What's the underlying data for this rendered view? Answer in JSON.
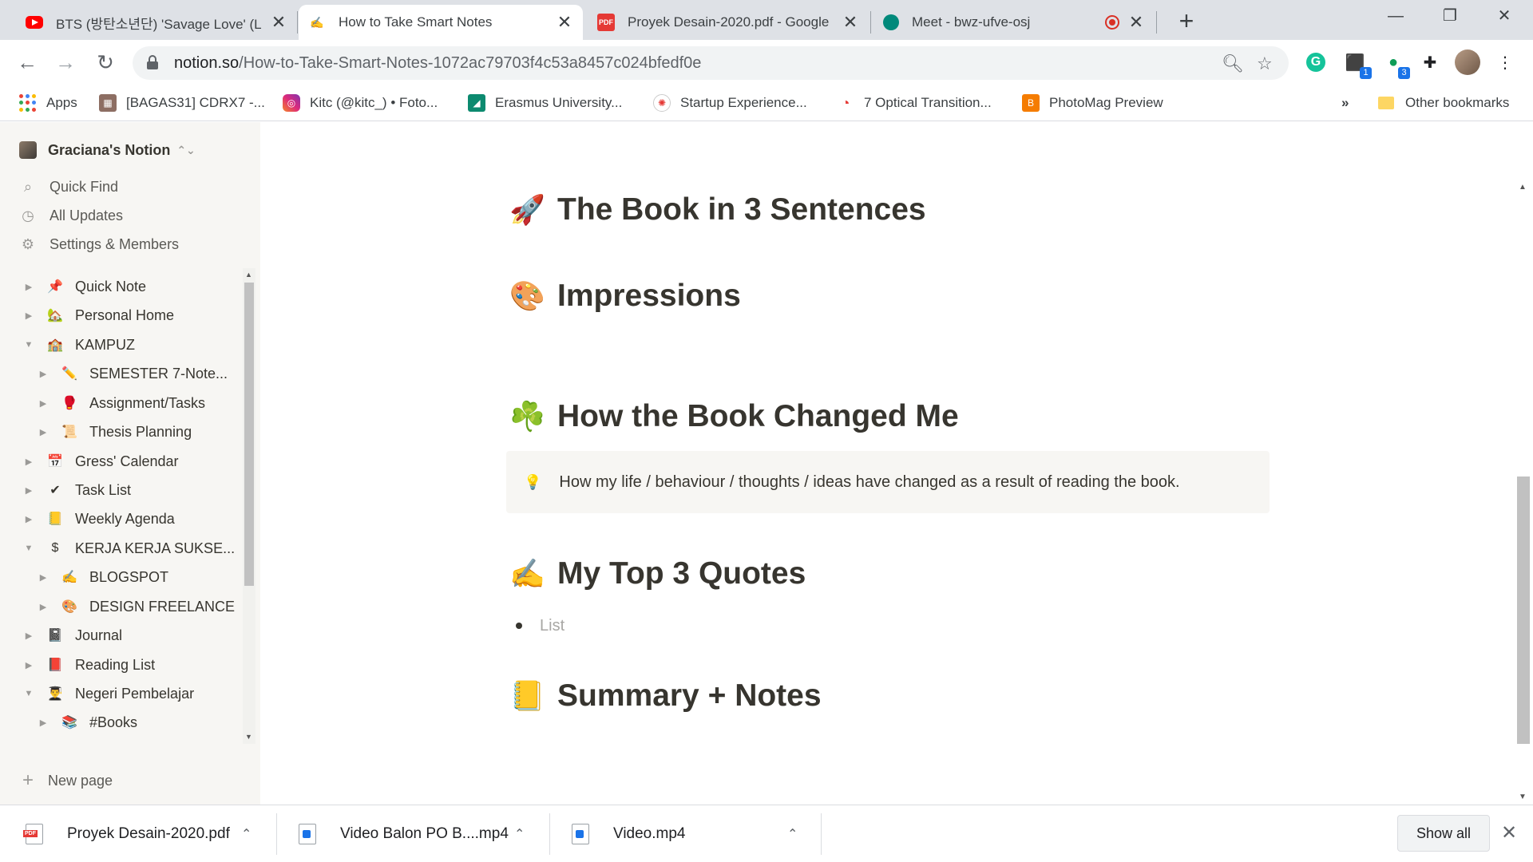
{
  "browser": {
    "tabs": [
      {
        "title": "BTS (방탄소년단) 'Savage Love' (L",
        "icon": "youtube-icon"
      },
      {
        "title": "How to Take Smart Notes",
        "icon": "writing-hand-icon",
        "active": true
      },
      {
        "title": "Proyek Desain-2020.pdf - Google",
        "icon": "pdf-icon"
      },
      {
        "title": "Meet - bwz-ufve-osj",
        "icon": "google-meet-icon",
        "recording": true
      }
    ],
    "url_host": "notion.so",
    "url_path": "/How-to-Take-Smart-Notes-1072ac79703f4c53a8457c024bfedf0e",
    "extension_badges": [
      "1",
      "3"
    ],
    "bookmarks": [
      {
        "label": "Apps",
        "icon": "apps-grid-icon"
      },
      {
        "label": "[BAGAS31] CDRX7 -...",
        "icon": "bagas31-icon"
      },
      {
        "label": "Kitc (@kitc_) • Foto...",
        "icon": "instagram-icon"
      },
      {
        "label": "Erasmus University...",
        "icon": "erasmus-icon"
      },
      {
        "label": "Startup Experience...",
        "icon": "startup-icon"
      },
      {
        "label": "7 Optical Transition...",
        "icon": "optical-icon"
      },
      {
        "label": "PhotoMag Preview",
        "icon": "blogger-icon"
      }
    ],
    "bookmarks_overflow": "»",
    "other_bookmarks": "Other bookmarks"
  },
  "sidebar": {
    "workspace": "Graciana's Notion",
    "top_items": [
      {
        "label": "Quick Find",
        "icon": "search-icon"
      },
      {
        "label": "All Updates",
        "icon": "clock-icon"
      },
      {
        "label": "Settings & Members",
        "icon": "gear-icon"
      }
    ],
    "tree": [
      {
        "label": "Quick Note",
        "emoji": "📌",
        "toggle": "▶",
        "depth": 0
      },
      {
        "label": "Personal Home",
        "emoji": "🏡",
        "toggle": "▶",
        "depth": 0
      },
      {
        "label": "KAMPUZ",
        "emoji": "🏫",
        "toggle": "▼",
        "depth": 0
      },
      {
        "label": "SEMESTER 7-Note...",
        "emoji": "✏️",
        "toggle": "▶",
        "depth": 1
      },
      {
        "label": "Assignment/Tasks",
        "emoji": "🥊",
        "toggle": "▶",
        "depth": 1
      },
      {
        "label": "Thesis Planning",
        "emoji": "📜",
        "toggle": "▶",
        "depth": 1
      },
      {
        "label": "Gress' Calendar",
        "emoji": "📅",
        "toggle": "▶",
        "depth": 0
      },
      {
        "label": "Task List",
        "emoji": "✔",
        "toggle": "▶",
        "depth": 0
      },
      {
        "label": "Weekly Agenda",
        "emoji": "📒",
        "toggle": "▶",
        "depth": 0
      },
      {
        "label": "KERJA KERJA SUKSE...",
        "emoji": "$",
        "toggle": "▼",
        "depth": 0
      },
      {
        "label": "BLOGSPOT",
        "emoji": "✍️",
        "toggle": "▶",
        "depth": 1
      },
      {
        "label": "DESIGN FREELANCE",
        "emoji": "🎨",
        "toggle": "▶",
        "depth": 1
      },
      {
        "label": "Journal",
        "emoji": "📓",
        "toggle": "▶",
        "depth": 0
      },
      {
        "label": "Reading List",
        "emoji": "📕",
        "toggle": "▶",
        "depth": 0
      },
      {
        "label": "Negeri Pembelajar",
        "emoji": "👨‍🎓",
        "toggle": "▼",
        "depth": 0
      },
      {
        "label": "#Books",
        "emoji": "📚",
        "toggle": "▶",
        "depth": 1
      }
    ],
    "new_page": "New page"
  },
  "page": {
    "headings": [
      {
        "emoji": "🚀",
        "text": "The Book in 3 Sentences"
      },
      {
        "emoji": "🎨",
        "text": "Impressions"
      },
      {
        "emoji": "☘️",
        "text": "How the Book Changed Me"
      },
      {
        "emoji": "✍️",
        "text": "My Top 3 Quotes"
      },
      {
        "emoji": "📒",
        "text": "Summary + Notes"
      }
    ],
    "callout": {
      "emoji": "💡",
      "text": "How my life / behaviour / thoughts / ideas have changed as a result of reading the book."
    },
    "list_placeholder": "List"
  },
  "downloads": {
    "items": [
      {
        "name": "Proyek Desain-2020.pdf",
        "type": "pdf"
      },
      {
        "name": "Video Balon PO B....mp4",
        "type": "video"
      },
      {
        "name": "Video.mp4",
        "type": "video"
      }
    ],
    "show_all": "Show all"
  }
}
